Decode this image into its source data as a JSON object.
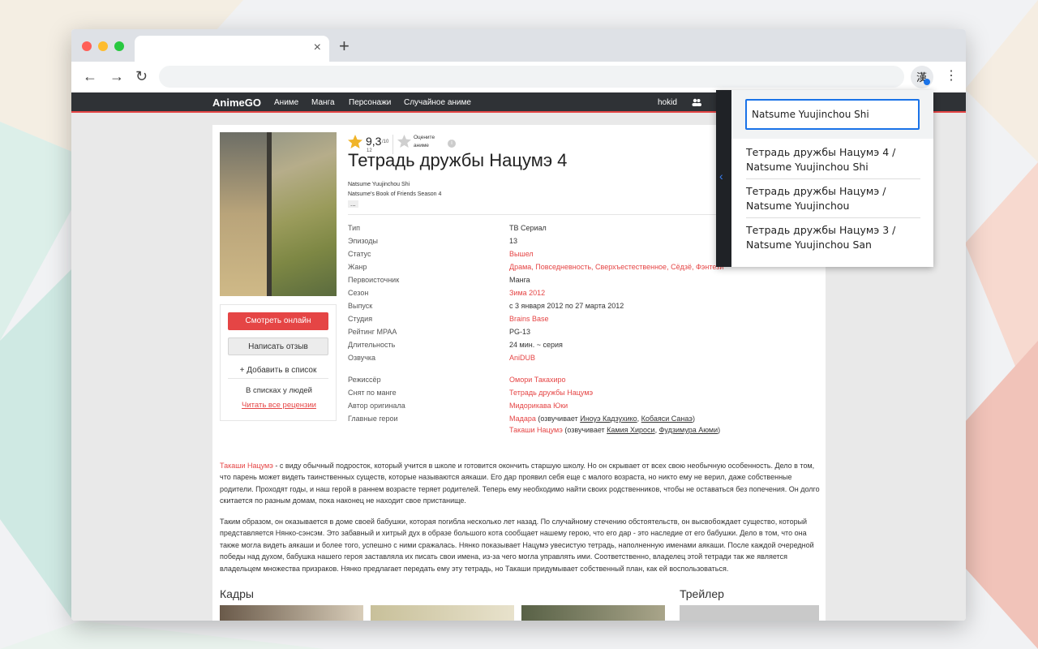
{
  "browser": {
    "tab_close": "×",
    "new_tab": "+",
    "back": "←",
    "forward": "→",
    "reload": "↻",
    "menu": "⋮",
    "extension_icon": "translate-icon"
  },
  "site": {
    "logo": "AnimeGO",
    "nav": [
      "Аниме",
      "Манга",
      "Персонажи",
      "Случайное аниме"
    ],
    "user": "hokid"
  },
  "anime": {
    "rating_value": "9,3",
    "rating_max": "/10",
    "rating_votes": "12",
    "rate_label_1": "Оцените",
    "rate_label_2": "аниме",
    "title": "Тетрадь дружбы Нацумэ 4",
    "alt_title_1": "Natsume Yuujinchou Shi",
    "alt_title_2": "Natsume's Book of Friends Season 4",
    "more": "...",
    "watch_button": "Смотреть онлайн",
    "review_button": "Написать отзыв",
    "add_list_button": "+ Добавить в список",
    "in_lists": "В списках у людей",
    "read_reviews": "Читать все рецензии"
  },
  "info": [
    {
      "label": "Тип",
      "value": "ТВ Сериал",
      "red": false
    },
    {
      "label": "Эпизоды",
      "value": "13",
      "red": false
    },
    {
      "label": "Статус",
      "value": "Вышел",
      "red": true
    },
    {
      "label": "Жанр",
      "value": "Драма, Повседневность, Сверхъестественное, Сёдзё, Фэнтези",
      "red": true
    },
    {
      "label": "Первоисточник",
      "value": "Манга",
      "red": false
    },
    {
      "label": "Сезон",
      "value": "Зима 2012",
      "red": true
    },
    {
      "label": "Выпуск",
      "value": "с 3 января 2012 по 27 марта 2012",
      "red": false
    },
    {
      "label": "Студия",
      "value": "Brains Base",
      "red": true
    },
    {
      "label": "Рейтинг MPAA",
      "value": "PG-13",
      "red": false
    },
    {
      "label": "Длительность",
      "value": "24 мин. ~ серия",
      "red": false
    },
    {
      "label": "Озвучка",
      "value": "AniDUB",
      "red": true
    }
  ],
  "staff": [
    {
      "label": "Режиссёр",
      "value": "Омори Такахиро"
    },
    {
      "label": "Снят по манге",
      "value": "Тетрадь дружбы Нацумэ"
    },
    {
      "label": "Автор оригинала",
      "value": "Мидорикава Юки"
    },
    {
      "label": "Главные герои",
      "value": "Мадара"
    }
  ],
  "heroes": {
    "hero1": "Мадара",
    "hero1_voice_prefix": " (озвучивает ",
    "hero1_va1": "Иноуэ Кадзухико",
    "hero1_va2": "Кобаяси Санаэ",
    "hero2": "Такаши Нацумэ",
    "hero2_voice_prefix": " (озвучивает ",
    "hero2_va1": "Камия Хироси",
    "hero2_va2": "Фудзимура Аюми",
    "comma": ", ",
    "close": ")"
  },
  "description": {
    "p1_link": "Такаши Нацумэ",
    "p1_rest": " - с виду обычный подросток, который учится в школе и готовится окончить старшую школу. Но он скрывает от всех свою необычную особенность. Дело в том, что парень может видеть таинственных существ, которые называются аякаши. Его дар проявил себя еще с малого возраста, но никто ему не верил, даже собственные родители. Проходят годы, и наш герой в раннем возрасте теряет родителей. Теперь ему необходимо найти своих родственников, чтобы не оставаться без попечения. Он долго скитается по разным домам, пока наконец не находит свое пристанище.",
    "p2": "Таким образом, он оказывается в доме своей бабушки, которая погибла несколько лет назад. По случайному стечению обстоятельств, он высвобождает существо, который представляется Нянко-сэнсэм. Это забавный и хитрый дух в образе большого кота сообщает нашему герою, что его дар - это наследие от его бабушки. Дело в том, что она также могла видеть аякаши и более того, успешно с ними сражалась. Нянко показывает Нацумэ увесистую тетрадь, наполненную именами аякаши. После каждой очередной победы над духом, бабушка нашего героя заставляла их писать свои имена, из-за чего могла управлять ими. Соответственно, владелец этой тетради так же является владельцем множества призраков. Нянко предлагает передать ему эту тетрадь, но Такаши придумывает собственный план, как ей воспользоваться."
  },
  "sections": {
    "frames": "Кадры",
    "trailer": "Трейлер"
  },
  "popup": {
    "query": "Natsume Yuujinchou Shi",
    "suggestions": [
      {
        "line1": "Тетрадь дружбы Нацумэ 4 /",
        "line2": "Natsume Yuujinchou Shi"
      },
      {
        "line1": "Тетрадь дружбы Нацумэ /",
        "line2": "Natsume Yuujinchou"
      },
      {
        "line1": "Тетрадь дружбы Нацумэ 3 /",
        "line2": "Natsume Yuujinchou San"
      }
    ]
  },
  "colors": {
    "accent": "#e54545",
    "navbar": "#2f3236",
    "link_blue": "#1a73e8"
  }
}
